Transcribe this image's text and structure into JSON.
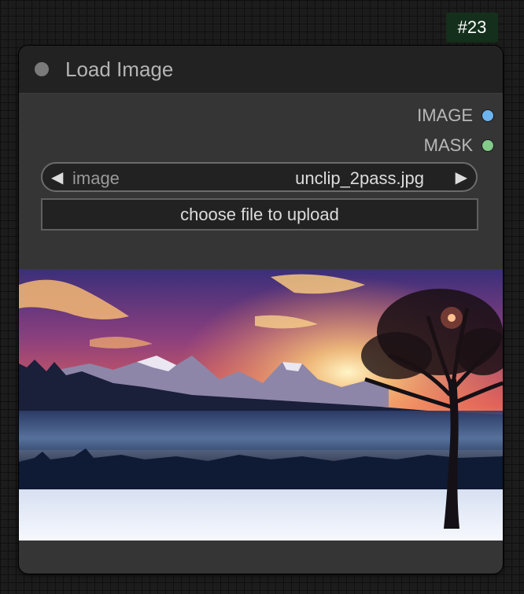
{
  "node_id_badge": "#23",
  "node": {
    "title": "Load Image",
    "outputs": [
      {
        "label": "IMAGE",
        "color": "#6cb4ef"
      },
      {
        "label": "MASK",
        "color": "#82c98a"
      }
    ],
    "image_widget": {
      "name": "image",
      "value": "unclip_2pass.jpg",
      "prev_arrow": "◀",
      "next_arrow": "▶"
    },
    "upload_button_label": "choose file to upload",
    "preview_description_icon": "landscape-preview"
  },
  "colors": {
    "node_bg": "#353535",
    "title_bg": "#222222",
    "badge_bg": "#14301c"
  }
}
